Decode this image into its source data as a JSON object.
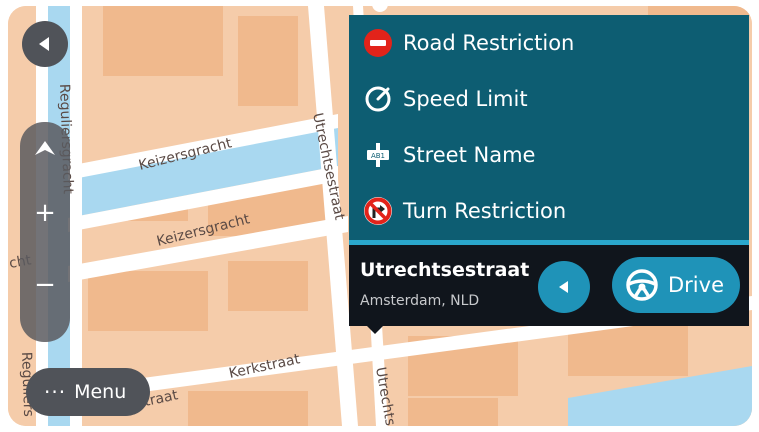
{
  "map": {
    "streets": {
      "keizersgracht_1": "Keizersgracht",
      "keizersgracht_2": "Keizersgracht",
      "utrechtsestraat_top": "Utrechtsestraat",
      "utrechtsestraat_bottom": "Utrechts",
      "kerkstraat_1": "Kerkstraat",
      "kerkstraat_2": "Kerkstraat",
      "reguliersgracht": "Reguliersgracht",
      "reguliers_bottom": "Reguliers",
      "edge_fragment": "cht"
    },
    "colors": {
      "blocks": "#f5ccaa",
      "buildings": "#f0b98d",
      "roads": "#ffffff",
      "water": "#a9d8f0"
    }
  },
  "controls": {
    "back_icon": "chevron-left-icon",
    "north_icon": "north-arrow-icon",
    "zoom_in": "+",
    "zoom_out": "−",
    "menu": {
      "icon": "more-dots-icon",
      "label": "Menu"
    }
  },
  "report_menu": {
    "items": [
      {
        "label": "Road Restriction",
        "icon": "no-entry-icon"
      },
      {
        "label": "Speed Limit",
        "icon": "speedometer-icon"
      },
      {
        "label": "Street Name",
        "icon": "street-sign-icon"
      },
      {
        "label": "Turn Restriction",
        "icon": "no-turn-icon"
      }
    ],
    "colors": {
      "background": "#0d5d72",
      "accent": "#2aa7cc"
    }
  },
  "location": {
    "name": "Utrechtsestraat",
    "subtitle": "Amsterdam, NLD",
    "back_icon": "chevron-left-icon",
    "drive": {
      "label": "Drive",
      "icon": "steering-wheel-icon"
    },
    "colors": {
      "background": "#10151c",
      "button": "#1f93b8"
    }
  }
}
